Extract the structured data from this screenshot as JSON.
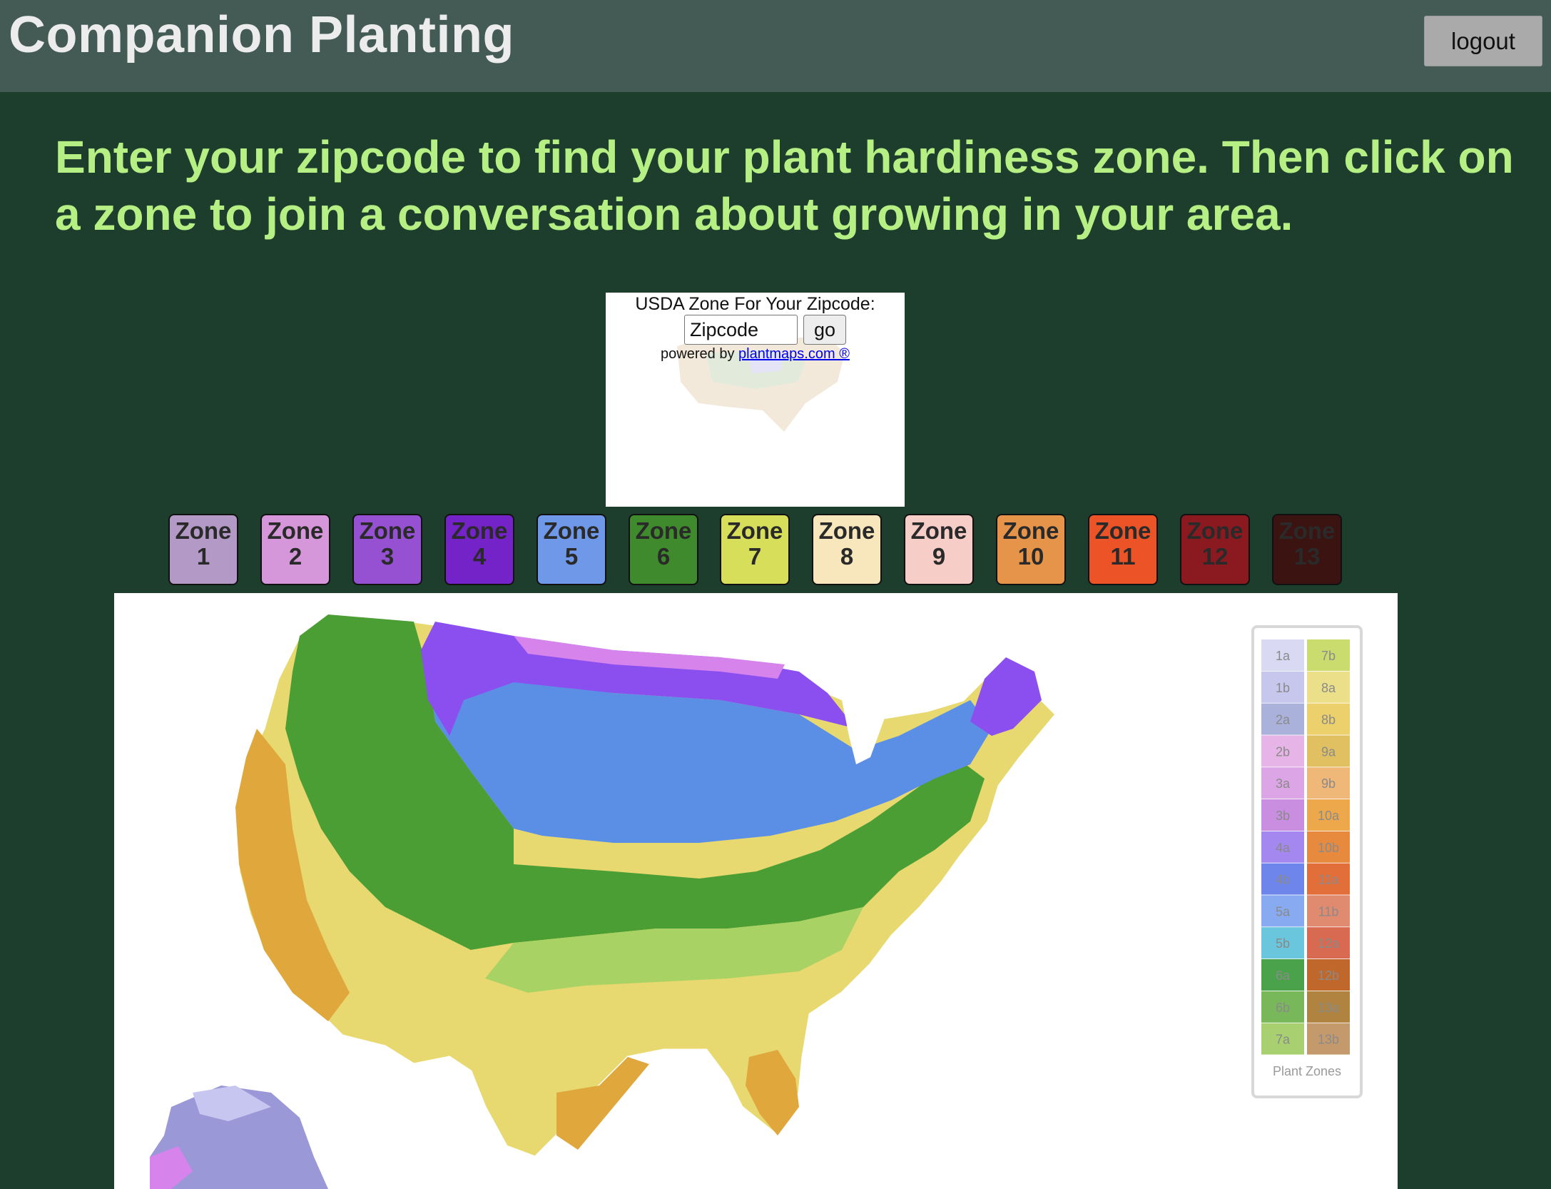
{
  "header": {
    "title": "Companion Planting",
    "logout_label": "logout"
  },
  "instructions": "Enter your zipcode to find your plant hardiness zone. Then click on a zone to join a conversation about growing in your area.",
  "zip_widget": {
    "label": "USDA Zone For Your Zipcode:",
    "input_placeholder": "Zipcode",
    "go_label": "go",
    "powered_by": "powered by",
    "link_text": "plantmaps.com ®"
  },
  "zones": [
    {
      "word": "Zone",
      "number": "1",
      "color": "#b39ac6",
      "text_color": "#2a2a2a"
    },
    {
      "word": "Zone",
      "number": "2",
      "color": "#d597da",
      "text_color": "#2a2a2a"
    },
    {
      "word": "Zone",
      "number": "3",
      "color": "#9551d1",
      "text_color": "#2a2a2a"
    },
    {
      "word": "Zone",
      "number": "4",
      "color": "#7423c8",
      "text_color": "#2a2a2a"
    },
    {
      "word": "Zone",
      "number": "5",
      "color": "#6f98e8",
      "text_color": "#2a2a2a"
    },
    {
      "word": "Zone",
      "number": "6",
      "color": "#3f8a2c",
      "text_color": "#2a2a2a"
    },
    {
      "word": "Zone",
      "number": "7",
      "color": "#d7de5a",
      "text_color": "#2a2a2a"
    },
    {
      "word": "Zone",
      "number": "8",
      "color": "#f8e6bd",
      "text_color": "#2a2a2a"
    },
    {
      "word": "Zone",
      "number": "9",
      "color": "#f7cdc8",
      "text_color": "#2a2a2a"
    },
    {
      "word": "Zone",
      "number": "10",
      "color": "#e59449",
      "text_color": "#2a2a2a"
    },
    {
      "word": "Zone",
      "number": "11",
      "color": "#ec5428",
      "text_color": "#2a2a2a"
    },
    {
      "word": "Zone",
      "number": "12",
      "color": "#8a1a1f",
      "text_color": "#2a2a2a"
    },
    {
      "word": "Zone",
      "number": "13",
      "color": "#3b1310",
      "text_color": "#2a2a2a"
    }
  ],
  "map": {
    "legend_title": "Plant Zones",
    "legend_left": [
      {
        "label": "1a",
        "color": "#d9d9f4"
      },
      {
        "label": "1b",
        "color": "#c7c7ee"
      },
      {
        "label": "2a",
        "color": "#aab2dc"
      },
      {
        "label": "2b",
        "color": "#e6b4e6"
      },
      {
        "label": "3a",
        "color": "#dca6e6"
      },
      {
        "label": "3b",
        "color": "#c98ee0"
      },
      {
        "label": "4a",
        "color": "#a488f0"
      },
      {
        "label": "4b",
        "color": "#6e86ec"
      },
      {
        "label": "5a",
        "color": "#88aaf0"
      },
      {
        "label": "5b",
        "color": "#6ac6dc"
      },
      {
        "label": "6a",
        "color": "#4aa34a"
      },
      {
        "label": "6b",
        "color": "#78b85a"
      },
      {
        "label": "7a",
        "color": "#a8cf70"
      }
    ],
    "legend_right": [
      {
        "label": "7b",
        "color": "#cbdc6e"
      },
      {
        "label": "8a",
        "color": "#ecdf8a"
      },
      {
        "label": "8b",
        "color": "#ecd06c"
      },
      {
        "label": "9a",
        "color": "#e0c060"
      },
      {
        "label": "9b",
        "color": "#f0b878"
      },
      {
        "label": "10a",
        "color": "#eca84a"
      },
      {
        "label": "10b",
        "color": "#e88a3e"
      },
      {
        "label": "11a",
        "color": "#e26e3a"
      },
      {
        "label": "11b",
        "color": "#e08a70"
      },
      {
        "label": "12a",
        "color": "#d86a52"
      },
      {
        "label": "12b",
        "color": "#c0682c"
      },
      {
        "label": "13a",
        "color": "#b08440"
      },
      {
        "label": "13b",
        "color": "#c49a6c"
      }
    ]
  }
}
